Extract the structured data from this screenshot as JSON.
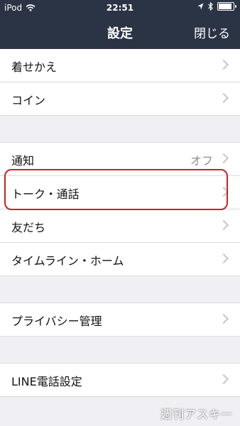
{
  "status": {
    "device": "iPod",
    "time": "22:51",
    "battery_level": 0.9
  },
  "nav": {
    "title": "設定",
    "close_label": "閉じる"
  },
  "sections": [
    {
      "items": [
        {
          "label": "着せかえ"
        },
        {
          "label": "コイン"
        }
      ]
    },
    {
      "items": [
        {
          "label": "通知",
          "value": "オフ"
        },
        {
          "label": "トーク・通話"
        },
        {
          "label": "友だち"
        },
        {
          "label": "タイムライン・ホーム"
        }
      ]
    },
    {
      "items": [
        {
          "label": "プライバシー管理"
        }
      ]
    },
    {
      "items": [
        {
          "label": "LINE電話設定"
        }
      ]
    }
  ],
  "watermark": "週刊アスキー",
  "colors": {
    "navbar": "#2b3445",
    "background": "#efeff4",
    "highlight": "#c8222b"
  }
}
